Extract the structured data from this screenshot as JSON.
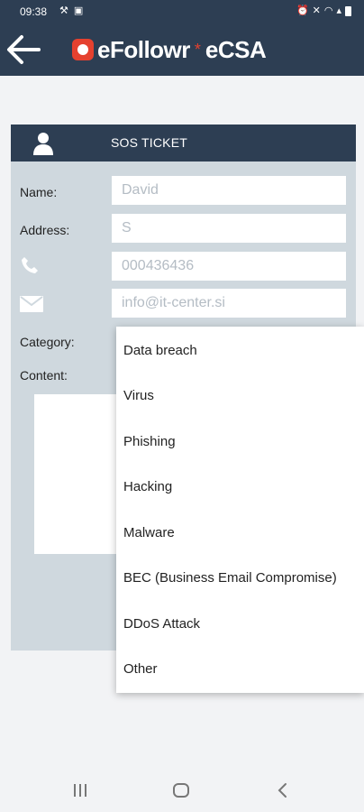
{
  "status_bar": {
    "time": "09:38"
  },
  "app": {
    "brand_left": "eFollowr",
    "brand_star": "*",
    "brand_right": "eCSA"
  },
  "ticket": {
    "title": "SOS TICKET",
    "labels": {
      "name": "Name:",
      "address": "Address:",
      "category": "Category:",
      "content": "Content:"
    },
    "fields": {
      "name": "David",
      "address": "S",
      "phone": "000436436",
      "email": "info@it-center.si"
    }
  },
  "category_dropdown": {
    "options": [
      "Data breach",
      "Virus",
      "Phishing",
      "Hacking",
      "Malware",
      "BEC (Business Email Compromise)",
      "DDoS Attack",
      "Other"
    ]
  },
  "colors": {
    "header": "#2d3e53",
    "card": "#cfd8de",
    "accent": "#e5412f",
    "background": "#f2f3f5"
  },
  "icons": [
    "back-arrow-icon",
    "user-icon",
    "phone-icon",
    "envelope-icon",
    "recents-icon",
    "home-icon",
    "back-icon"
  ]
}
